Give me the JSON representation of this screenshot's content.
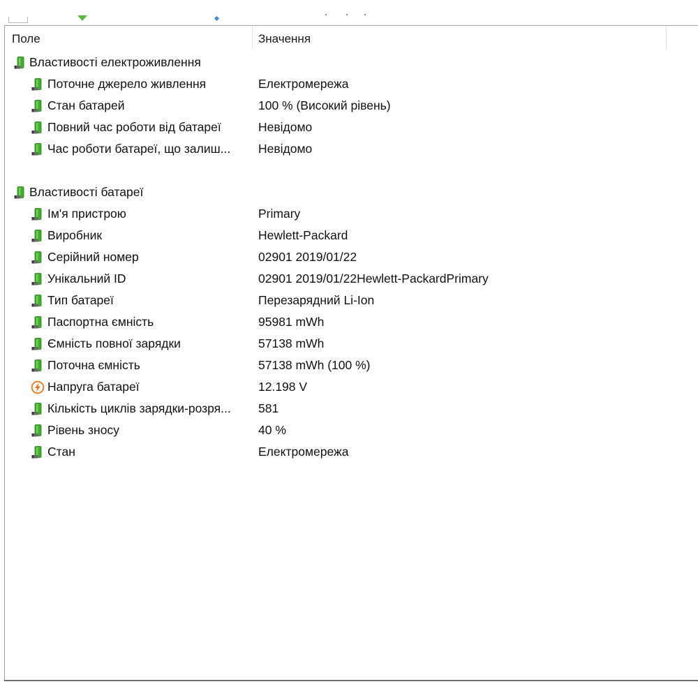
{
  "header": {
    "col_field": "Поле",
    "col_value": "Значення"
  },
  "groups": [
    {
      "title": "Властивості електроживлення",
      "icon": "battery-icon",
      "rows": [
        {
          "field": "Поточне джерело живлення",
          "value": "Електромережа",
          "icon": "battery-icon"
        },
        {
          "field": "Стан батарей",
          "value": "100 % (Високий рівень)",
          "icon": "battery-icon"
        },
        {
          "field": "Повний час роботи від батареї",
          "value": "Невідомо",
          "icon": "battery-icon"
        },
        {
          "field": "Час роботи батареї, що залиш...",
          "value": "Невідомо",
          "icon": "battery-icon"
        }
      ]
    },
    {
      "title": "Властивості батареї",
      "icon": "battery-icon",
      "rows": [
        {
          "field": "Ім'я пристрою",
          "value": "Primary",
          "icon": "battery-icon"
        },
        {
          "field": "Виробник",
          "value": "Hewlett-Packard",
          "icon": "battery-icon"
        },
        {
          "field": "Серійний номер",
          "value": "02901 2019/01/22",
          "icon": "battery-icon"
        },
        {
          "field": "Унікальний ID",
          "value": "02901 2019/01/22Hewlett-PackardPrimary",
          "icon": "battery-icon"
        },
        {
          "field": "Тип батареї",
          "value": "Перезарядний Li-Ion",
          "icon": "battery-icon"
        },
        {
          "field": "Паспортна ємність",
          "value": "95981 mWh",
          "icon": "battery-icon"
        },
        {
          "field": "Ємність повної зарядки",
          "value": "57138 mWh",
          "icon": "battery-icon"
        },
        {
          "field": "Поточна ємність",
          "value": "57138 mWh  (100 %)",
          "icon": "battery-icon"
        },
        {
          "field": "Напруга батареї",
          "value": "12.198 V",
          "icon": "voltage-icon"
        },
        {
          "field": "Кількість циклів зарядки-розря...",
          "value": "581",
          "icon": "battery-icon"
        },
        {
          "field": "Рівень зносу",
          "value": "40 %",
          "icon": "battery-icon"
        },
        {
          "field": "Стан",
          "value": "Електромережа",
          "icon": "battery-icon"
        }
      ]
    }
  ],
  "colors": {
    "battery_green": "#3fae2a",
    "voltage_orange": "#e8791c"
  }
}
